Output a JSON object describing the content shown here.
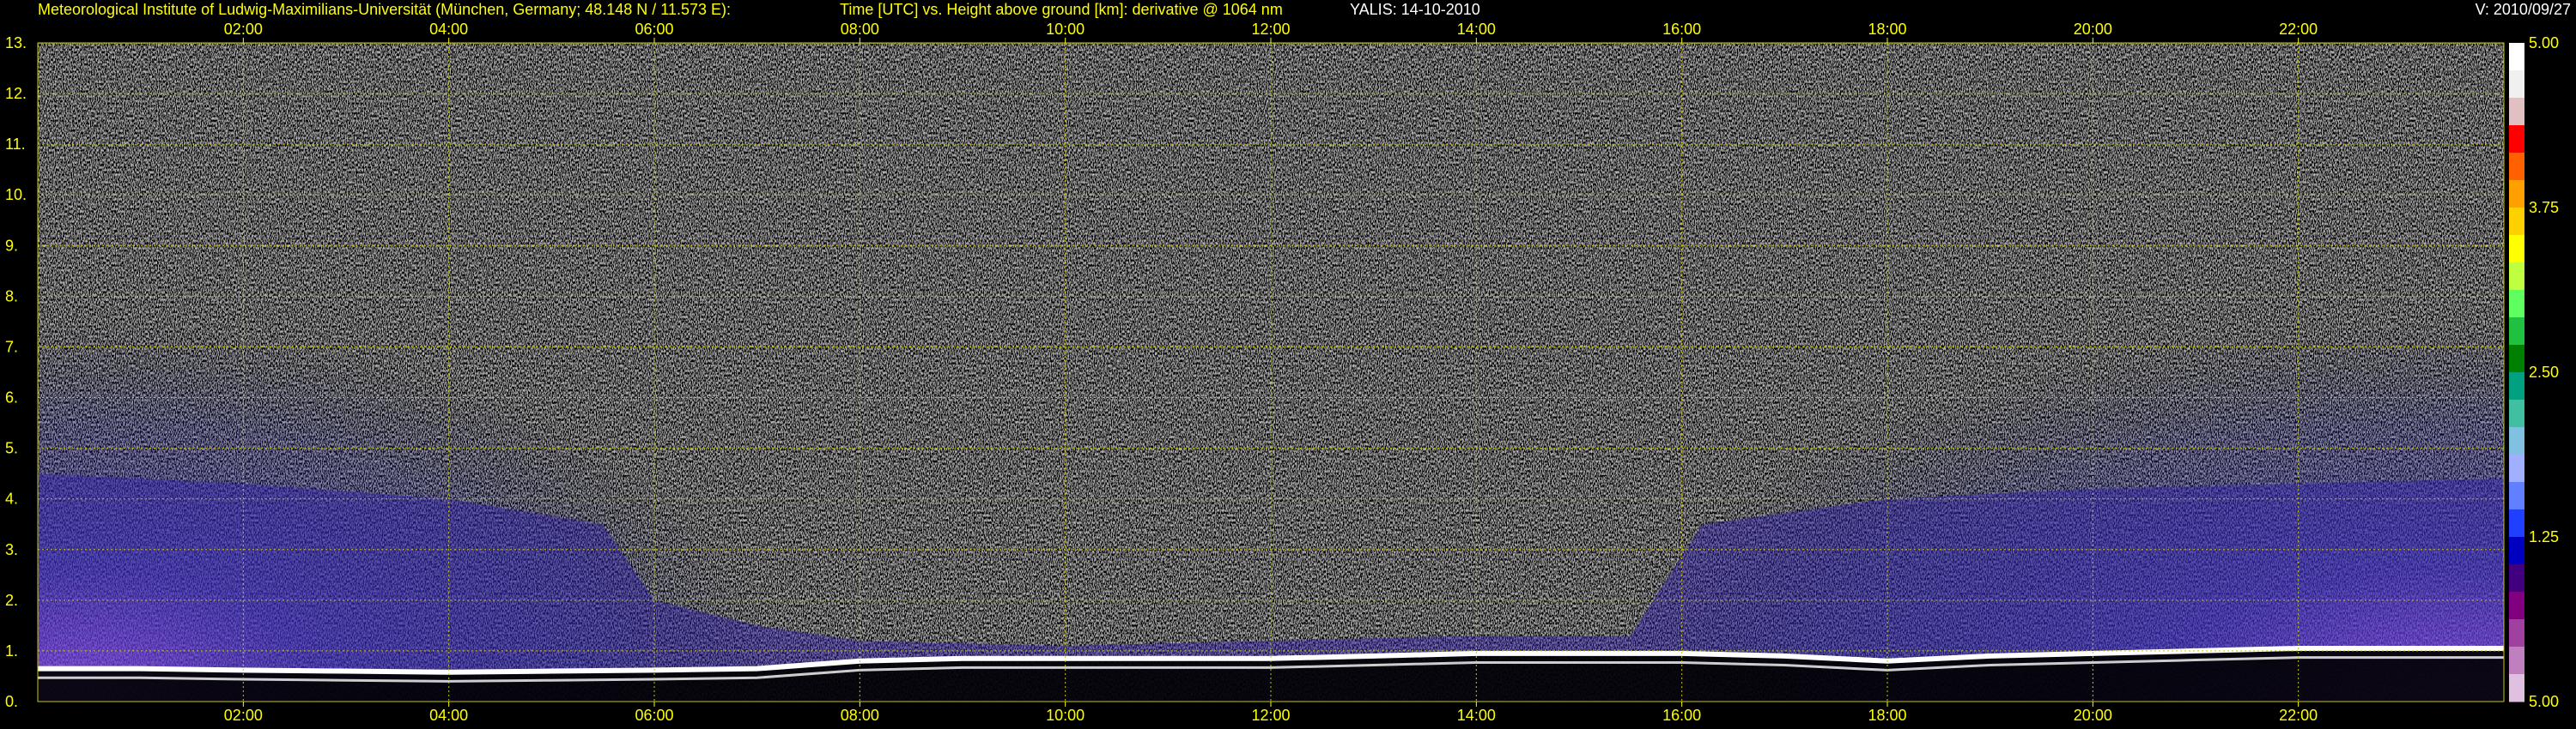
{
  "header": {
    "institute": "Meteorological Institute of Ludwig-Maximilians-Universität (München, Germany; 48.148 N / 11.573 E):",
    "plot_desc": "Time [UTC] vs. Height above ground [km]: derivative @ 1064 nm",
    "station_date": "YALIS: 14-10-2010",
    "version": "V: 2010/09/27"
  },
  "chart_data": {
    "type": "heatmap",
    "title": "Time [UTC] vs. Height above ground [km]: derivative @ 1064 nm",
    "xlabel": "Time [UTC]",
    "ylabel": "Height above ground [km]",
    "xlim": [
      0,
      24
    ],
    "ylim": [
      0,
      13
    ],
    "x_ticks": [
      "02:00",
      "04:00",
      "06:00",
      "08:00",
      "10:00",
      "12:00",
      "14:00",
      "16:00",
      "18:00",
      "20:00",
      "22:00"
    ],
    "x_tick_hours": [
      2,
      4,
      6,
      8,
      10,
      12,
      14,
      16,
      18,
      20,
      22
    ],
    "y_ticks": [
      "0.",
      "1.",
      "2.",
      "3.",
      "4.",
      "5.",
      "6.",
      "7.",
      "8.",
      "9.",
      "10.",
      "11.",
      "12.",
      "13."
    ],
    "y_tick_values": [
      0,
      1,
      2,
      3,
      4,
      5,
      6,
      7,
      8,
      9,
      10,
      11,
      12,
      13
    ],
    "grid": true,
    "colorbar": {
      "labels": [
        "5.00",
        "3.75",
        "2.50",
        "1.25",
        "5.00"
      ],
      "colors": [
        "#ffffff",
        "#f0f0f0",
        "#e0c0c0",
        "#ff0000",
        "#ff6000",
        "#ffa000",
        "#ffd000",
        "#ffff00",
        "#c0ff40",
        "#60ff60",
        "#20c040",
        "#008000",
        "#00a080",
        "#40c0a0",
        "#80c0e0",
        "#a0b0ff",
        "#6080ff",
        "#2040ff",
        "#0000c0",
        "#400080",
        "#800080",
        "#a040a0",
        "#c080c0",
        "#e0c0e0"
      ]
    },
    "boundary_layer_top_km": [
      [
        0,
        0.65
      ],
      [
        1,
        0.65
      ],
      [
        2,
        0.62
      ],
      [
        3,
        0.6
      ],
      [
        4,
        0.58
      ],
      [
        5,
        0.6
      ],
      [
        6,
        0.62
      ],
      [
        7,
        0.65
      ],
      [
        8,
        0.8
      ],
      [
        9,
        0.85
      ],
      [
        10,
        0.85
      ],
      [
        11,
        0.85
      ],
      [
        12,
        0.85
      ],
      [
        13,
        0.9
      ],
      [
        14,
        0.95
      ],
      [
        15,
        0.95
      ],
      [
        16,
        0.95
      ],
      [
        17,
        0.9
      ],
      [
        18,
        0.8
      ],
      [
        19,
        0.9
      ],
      [
        20,
        0.95
      ],
      [
        21,
        1.0
      ],
      [
        22,
        1.05
      ],
      [
        23,
        1.05
      ],
      [
        24,
        1.05
      ]
    ],
    "aerosol_layer_top_km": [
      [
        0,
        4.5
      ],
      [
        2,
        4.3
      ],
      [
        4,
        4.0
      ],
      [
        5.5,
        3.5
      ],
      [
        6,
        2.0
      ],
      [
        7,
        1.5
      ],
      [
        8,
        1.2
      ],
      [
        10,
        1.1
      ],
      [
        12,
        1.2
      ],
      [
        14,
        1.3
      ],
      [
        15.5,
        1.3
      ],
      [
        16.2,
        3.5
      ],
      [
        18,
        4.0
      ],
      [
        20,
        4.2
      ],
      [
        22,
        4.3
      ],
      [
        24,
        4.4
      ]
    ]
  }
}
